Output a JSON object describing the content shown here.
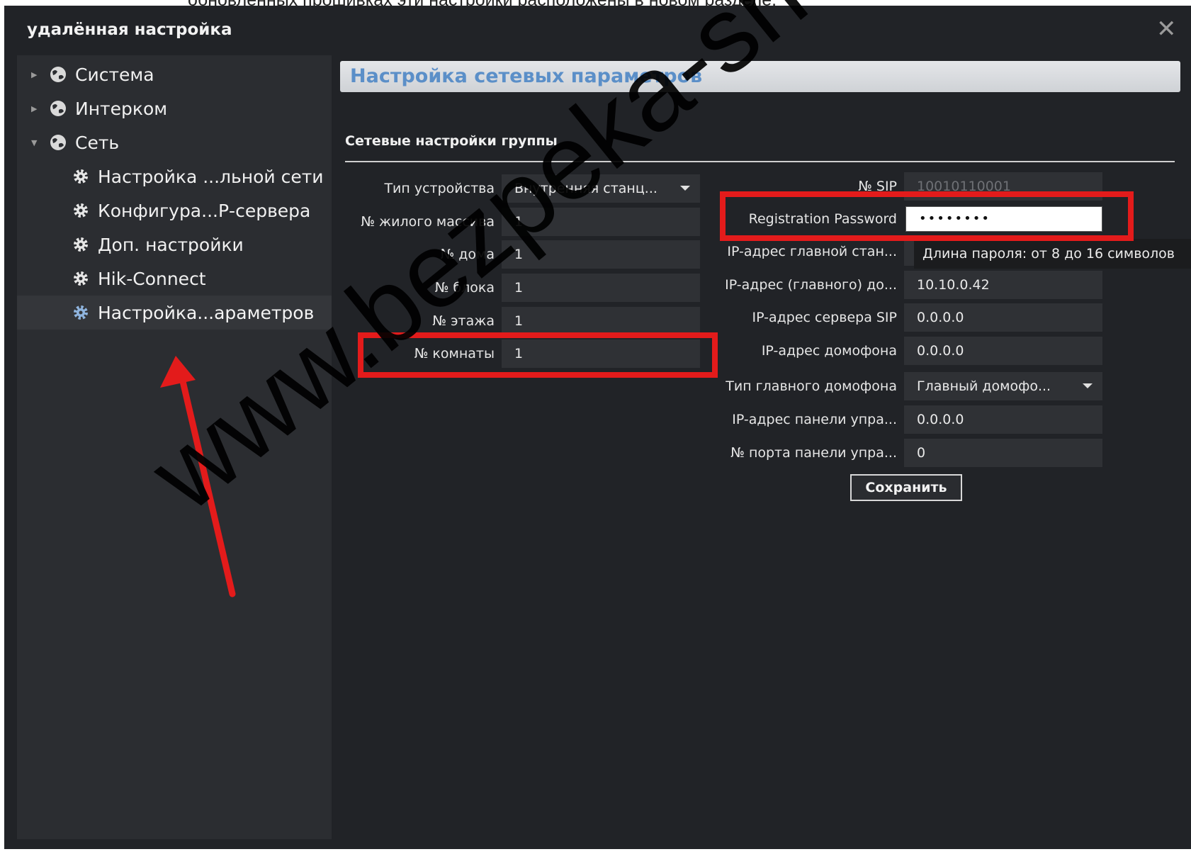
{
  "captions": {
    "top": "обновленных прошивках эти настройки расположены в новом разделе.",
    "bottom": ""
  },
  "window": {
    "title": "удалённая настройка",
    "close_icon": "close-icon"
  },
  "sidebar": {
    "items": [
      {
        "label": "Система",
        "icon": "globe-icon",
        "expanded": false
      },
      {
        "label": "Интерком",
        "icon": "globe-icon",
        "expanded": false
      },
      {
        "label": "Сеть",
        "icon": "globe-icon",
        "expanded": true
      },
      {
        "label": "Настройка ...льной сети",
        "icon": "gear-icon"
      },
      {
        "label": "Конфигура...Р-сервера",
        "icon": "gear-icon"
      },
      {
        "label": "Доп. настройки",
        "icon": "gear-icon"
      },
      {
        "label": "Hik-Connect",
        "icon": "gear-icon"
      },
      {
        "label": "Настройка...араметров",
        "icon": "gear-icon",
        "selected": true
      }
    ]
  },
  "main": {
    "title": "Настройка сетевых параметров",
    "section_title": "Сетевые настройки группы",
    "left_fields": [
      {
        "label": "Тип устройства",
        "value": "Внутренняя станц...",
        "dropdown": true
      },
      {
        "label": "№ жилого массива",
        "value": "1"
      },
      {
        "label": "№ дома",
        "value": "1"
      },
      {
        "label": "№ блока",
        "value": "1"
      },
      {
        "label": "№ этажа",
        "value": "1"
      },
      {
        "label": "№ комнаты",
        "value": "1"
      }
    ],
    "right_fields": [
      {
        "label": "№ SIP",
        "value": "10010110001"
      },
      {
        "label": "Registration Password",
        "value": "••••••••"
      },
      {
        "label": "IP-адрес главной стан...",
        "value": ""
      },
      {
        "label": "IP-адрес (главного) до...",
        "value": "10.10.0.42"
      },
      {
        "label": "IP-адрес сервера SIP",
        "value": "0.0.0.0"
      },
      {
        "label": "IP-адрес домофона",
        "value": "0.0.0.0"
      },
      {
        "label": "Тип главного домофона",
        "value": "Главный домофо...",
        "dropdown": true
      },
      {
        "label": "IP-адрес панели упра...",
        "value": "0.0.0.0"
      },
      {
        "label": "№ порта панели упра...",
        "value": "0"
      }
    ],
    "tooltip": "Длина пароля: от 8 до 16 символов",
    "save_label": "Сохранить"
  },
  "watermark": "www.bezpeka-shop.com",
  "colors": {
    "window_bg": "#212327",
    "sidebar_bg": "#2b2d31",
    "title_text": "#5b8fc8",
    "highlight_red": "#e31b1b"
  }
}
